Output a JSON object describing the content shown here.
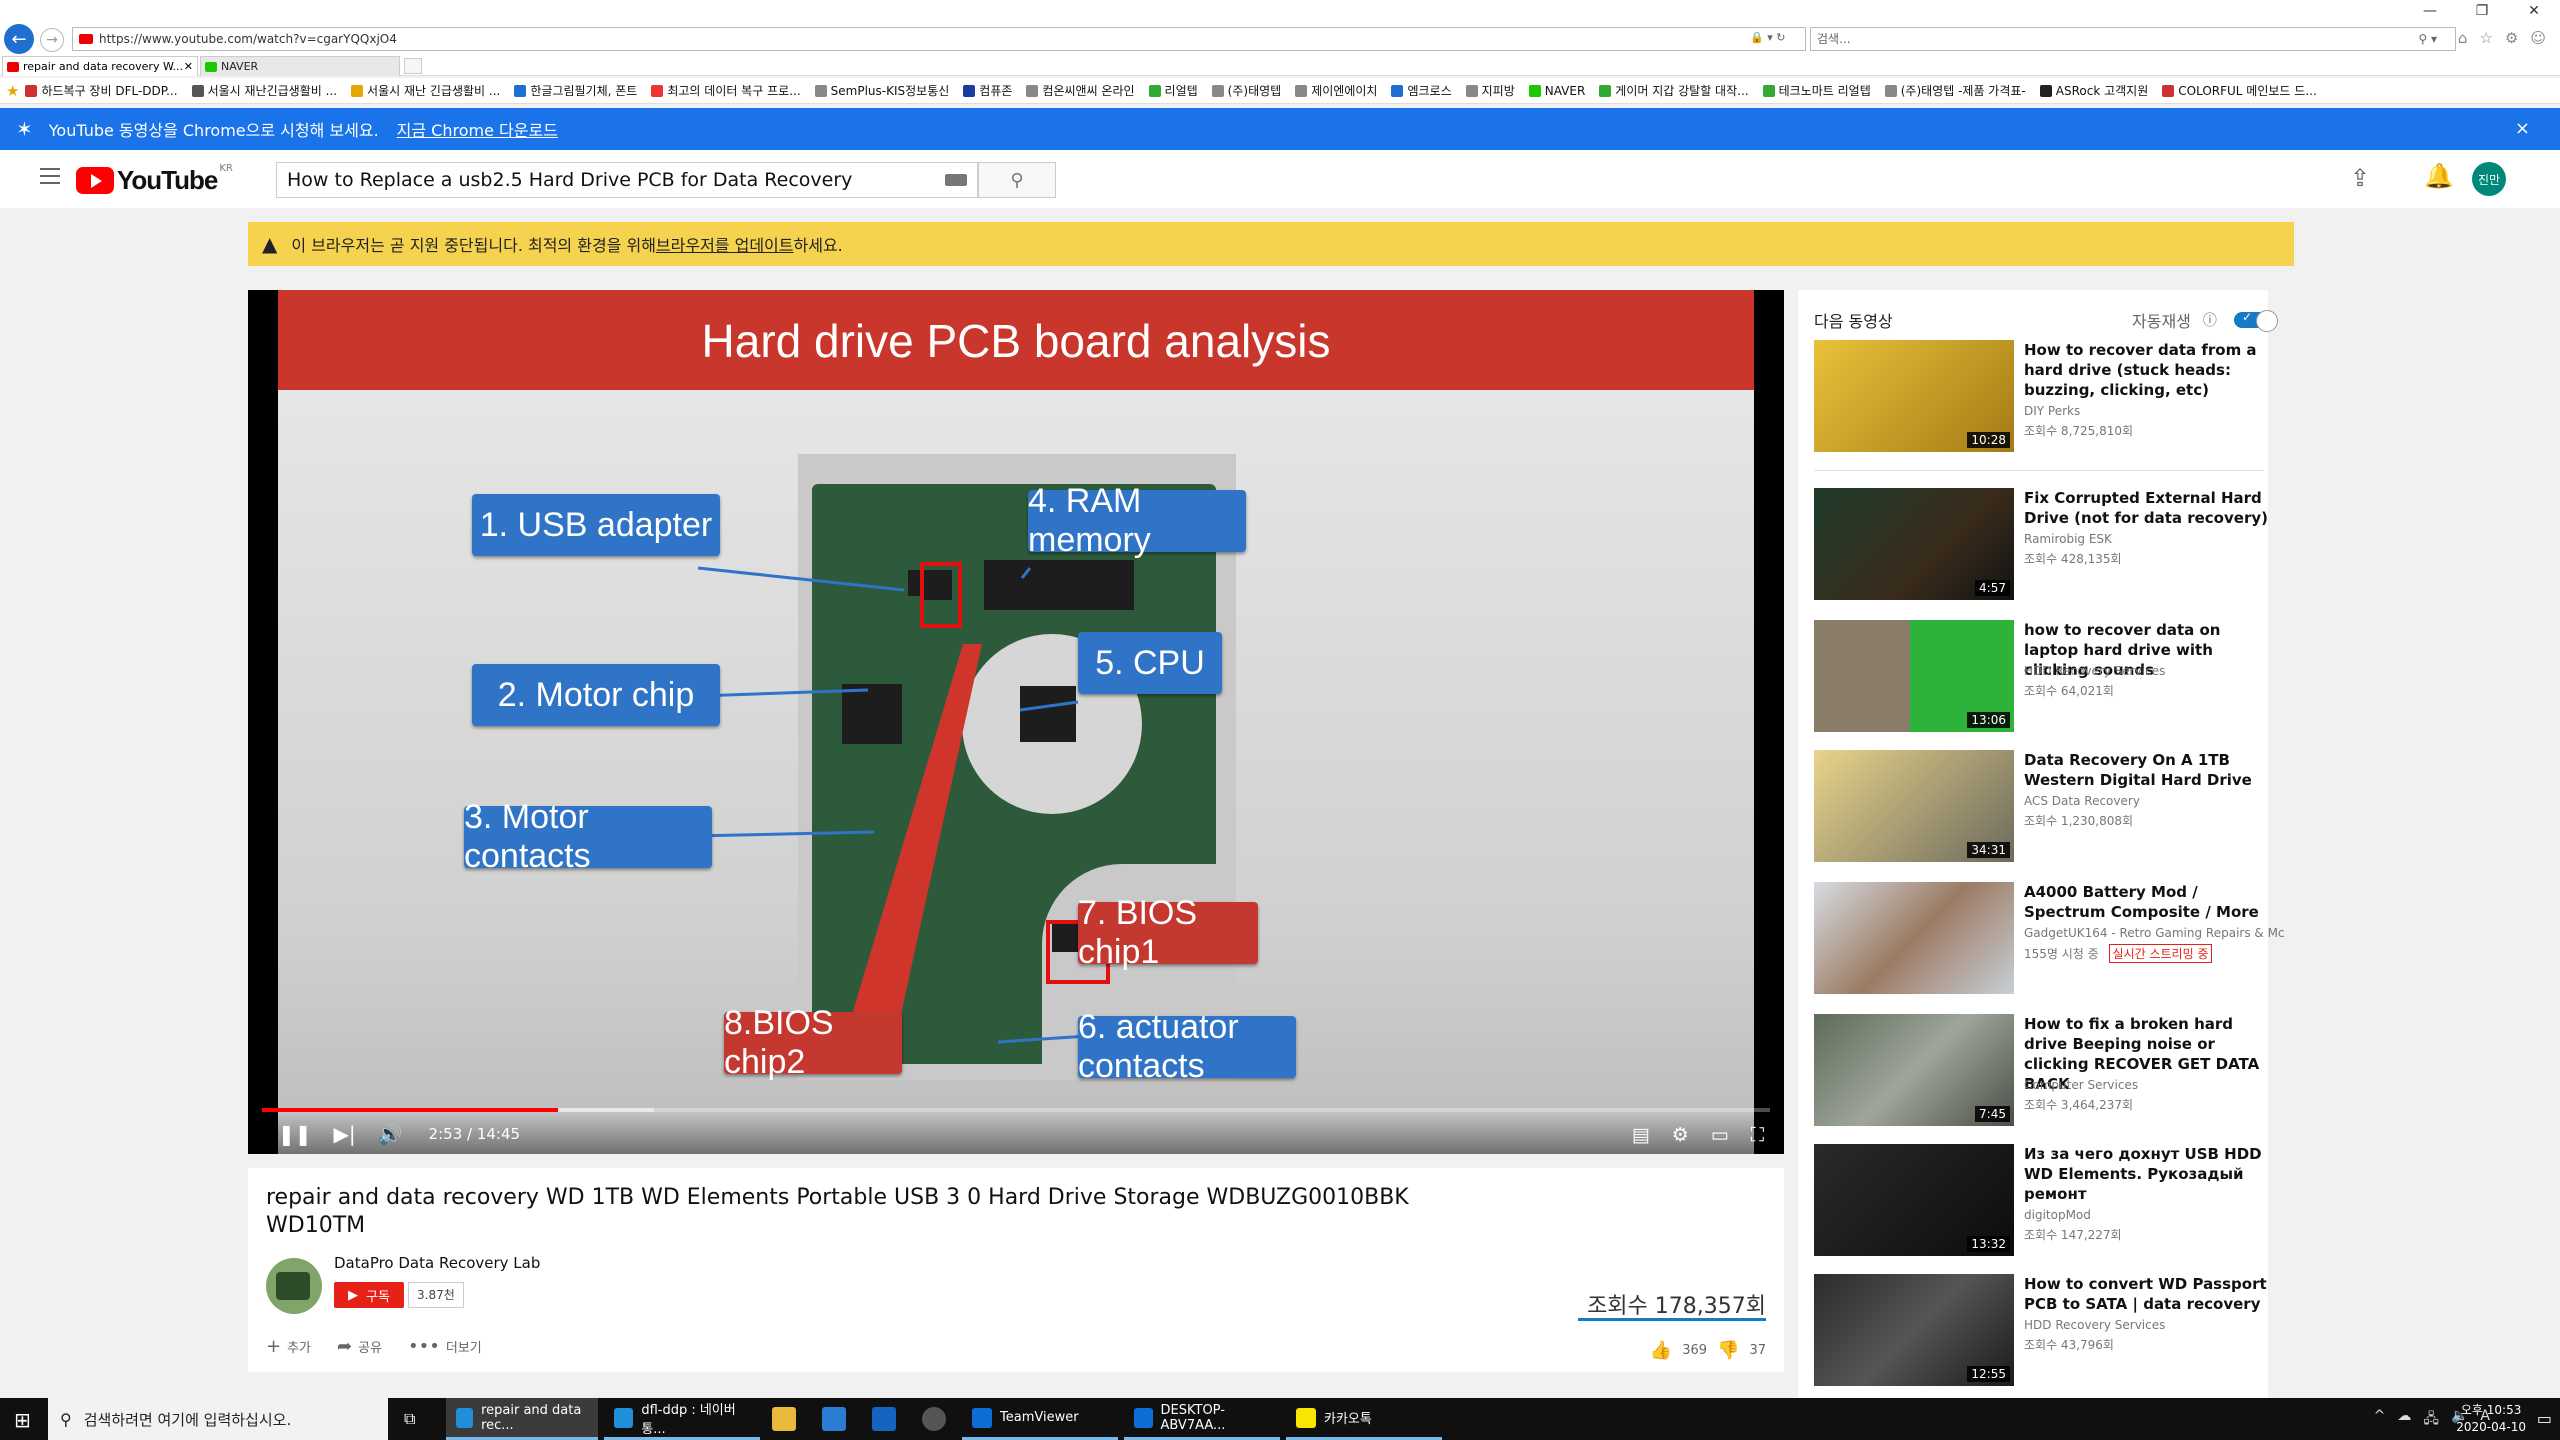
{
  "browser": {
    "url": "https://www.youtube.com/watch?v=cgarYQQxjO4",
    "search_placeholder": "검색...",
    "tabs": [
      {
        "label": "repair and data recovery W..."
      },
      {
        "label": "NAVER"
      }
    ],
    "favorites": [
      "하드복구 장비 DFL-DDP...",
      "서울시 재난긴급생활비 ...",
      "서울시 재난 긴급생활비 ...",
      "한글그림필기체, 폰트",
      "최고의 데이터 복구 프로...",
      "SemPlus-KIS정보통신",
      "컴퓨존",
      "컴온씨앤씨 온라인",
      "리얼텝",
      "(주)태영텝",
      "제이엔에이치",
      "엠크로스",
      "지피방",
      "NAVER",
      "게이머 지갑 강탈할 대작...",
      "테크노마트 리얼텝",
      "(주)태영텝 -제품 가격표-",
      "ASRock 고객지원",
      "COLORFUL 메인보드 드..."
    ]
  },
  "banner": {
    "text": "YouTube 동영상을 Chrome으로 시청해 보세요.",
    "link": "지금 Chrome 다운로드",
    "close": "×"
  },
  "header": {
    "logo": "YouTube",
    "region": "KR",
    "search_value": "How to Replace a usb2.5 Hard Drive PCB for Data Recovery",
    "avatar_text": "진만"
  },
  "warning": {
    "text_before": "이 브라우저는 곧 지원 중단됩니다. 최적의 환경을 위해 ",
    "link": "브라우저를 업데이트",
    "text_after": "하세요."
  },
  "slide": {
    "title": "Hard drive PCB board analysis",
    "labels": {
      "usb": "1. USB adapter",
      "motor_chip": "2. Motor chip",
      "motor_contacts": "3. Motor contacts",
      "ram": "4. RAM memory",
      "cpu": "5. CPU",
      "actuator": "6. actuator contacts",
      "bios1": "7. BIOS chip1",
      "bios2": "8.BIOS chip2"
    }
  },
  "player": {
    "time": "2:53 / 14:45",
    "progress_fraction": 0.196,
    "buffered_fraction": 0.26
  },
  "video": {
    "title": "repair and data recovery WD 1TB WD Elements Portable USB 3 0 Hard Drive Storage WDBUZG0010BBK WD10TM",
    "channel": "DataPro Data Recovery Lab",
    "subscribe": "구독",
    "subscribers": "3.87천",
    "views": "조회수 178,357회",
    "actions": {
      "add": "추가",
      "share": "공유",
      "more": "더보기"
    },
    "likes": "369",
    "dislikes": "37"
  },
  "sidebar": {
    "up_next": "다음 동영상",
    "autoplay": "자동재생",
    "items": [
      {
        "title": "How to recover data from a hard drive (stuck heads: buzzing, clicking, etc)",
        "channel": "DIY Perks",
        "views": "조회수 8,725,810회",
        "duration": "10:28"
      },
      {
        "title": "Fix Corrupted External Hard Drive (not for data recovery)",
        "channel": "Ramirobig ESK",
        "views": "조회수 428,135회",
        "duration": "4:57"
      },
      {
        "title": "how to recover data on laptop hard drive with clicking sounds",
        "channel": "HDD Recovery Services",
        "views": "조회수 64,021회",
        "duration": "13:06"
      },
      {
        "title": "Data Recovery On A 1TB Western Digital Hard Drive",
        "channel": "ACS Data Recovery",
        "views": "조회수 1,230,808회",
        "duration": "34:31"
      },
      {
        "title": "A4000 Battery Mod / Spectrum Composite / More",
        "channel": "GadgetUK164 - Retro Gaming Repairs & Mc",
        "views": "155명 시청 중",
        "live": "실시간 스트리밍 중",
        "duration": ""
      },
      {
        "title": "How to fix a broken hard drive Beeping noise or clicking RECOVER GET DATA BACK",
        "channel": "Computer Services",
        "views": "조회수 3,464,237회",
        "duration": "7:45"
      },
      {
        "title": "Из за чего дохнут USB HDD WD Elements. Рукозадый ремонт",
        "channel": "digitopMod",
        "views": "조회수 147,227회",
        "duration": "13:32"
      },
      {
        "title": "How to convert WD Passport PCB to SATA | data recovery",
        "channel": "HDD Recovery Services",
        "views": "조회수 43,796회",
        "duration": "12:55"
      }
    ]
  },
  "taskbar": {
    "search": "검색하려면 여기에 입력하십시오.",
    "apps": [
      "repair and data rec...",
      "dfl-ddp : 네이버 통...",
      "TeamViewer",
      "DESKTOP-ABV7AA...",
      "카카오톡"
    ],
    "time": "오후 10:53",
    "date": "2020-04-10"
  },
  "colors": {
    "yt_red": "#ff0000",
    "banner_blue": "#1a73e8",
    "warning_yellow": "#f5d34e",
    "slide_blue_label": "#2f74c6",
    "slide_red_label": "#c4382f"
  }
}
